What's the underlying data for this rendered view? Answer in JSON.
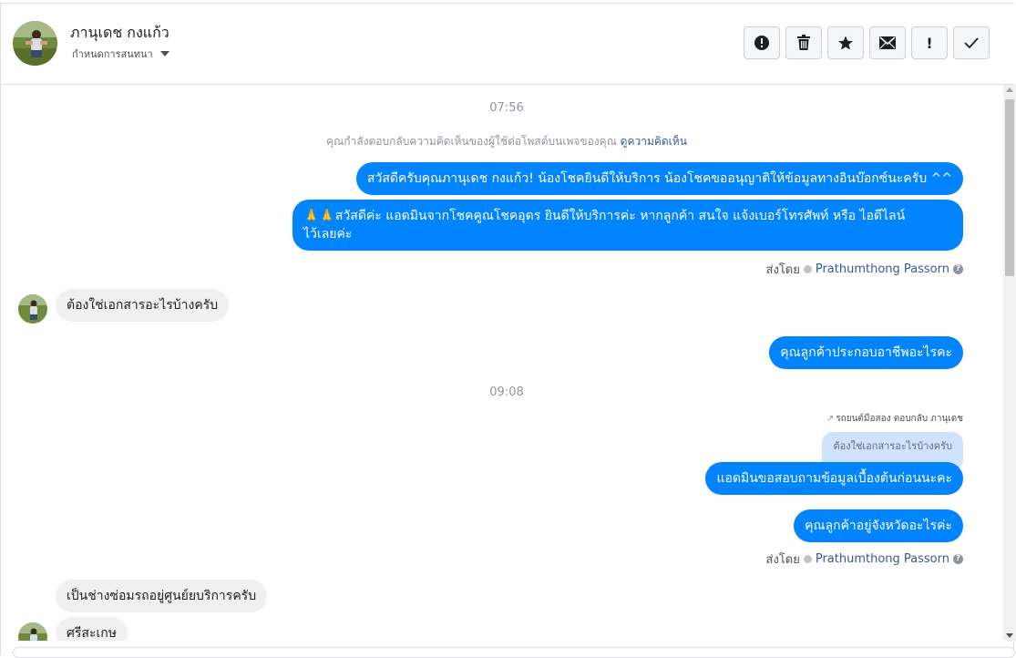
{
  "header": {
    "contact_name": "ภานุเดช กงแก้ว",
    "assign_label": "กำหนดการสนทนา",
    "actions": [
      {
        "name": "mark-spam-button",
        "icon": "alert-circle-icon"
      },
      {
        "name": "delete-button",
        "icon": "trash-icon"
      },
      {
        "name": "star-button",
        "icon": "star-icon"
      },
      {
        "name": "mark-unread-button",
        "icon": "envelope-icon"
      },
      {
        "name": "follow-up-button",
        "icon": "exclamation-icon",
        "glyph": "!"
      },
      {
        "name": "mark-done-button",
        "icon": "checkmark-icon"
      }
    ]
  },
  "chat": {
    "time_1": "07:56",
    "system_notice": "คุณกำลังตอบกลับความคิดเห็นของผู้ใช้ต่อโพสต์บนเพจของคุณ",
    "system_link": "ดูความคิดเห็น",
    "msg_out_1": "สวัสดีครับคุณภานุเดช กงแก้ว! น้องโชคยินดีให้บริการ น้องโชคขออนุญาติให้ข้อมูลทางอินบ๊อกซ์นะครับ ^^",
    "msg_out_2_line1": "🙏🙏สวัสดีค่ะ แอดมินจากโชคคูณโชคอุดร ยินดีให้บริการค่ะ หากลูกค้า สนใจ แจ้งเบอร์โทรศัพท์ หรือ ไอดีไลน์",
    "msg_out_2_line2": "ไว้เลยค่ะ",
    "sent_by_label": "ส่งโดย",
    "sent_by_agent": "Prathumthong Passorn",
    "msg_in_1": "ต้องใช่เอกสารอะไรบ้างครับ",
    "msg_out_3": "คุณลูกค้าประกอบอาชีพอะไรคะ",
    "time_2": "09:08",
    "reply_meta": "รถยนต์มือสอง ตอบกลับ ภานุเดช",
    "reply_quote": "ต้องใช่เอกสารอะไรบ้างครับ",
    "msg_out_4": "แอดมินขอสอบถามข้อมูลเบื้องต้นก่อนนะคะ",
    "msg_out_5": "คุณลูกค้าอยู่จังหวัดอะไรค่ะ",
    "msg_in_2": "เป็นช่างซ่อมรถอยู่ศูนย์ยบริการครับ",
    "msg_in_3": "ศรีสะเกษ"
  },
  "colors": {
    "outgoing_bubble": "#0084ff",
    "incoming_bubble": "#f1f0f0",
    "link": "#365899"
  }
}
